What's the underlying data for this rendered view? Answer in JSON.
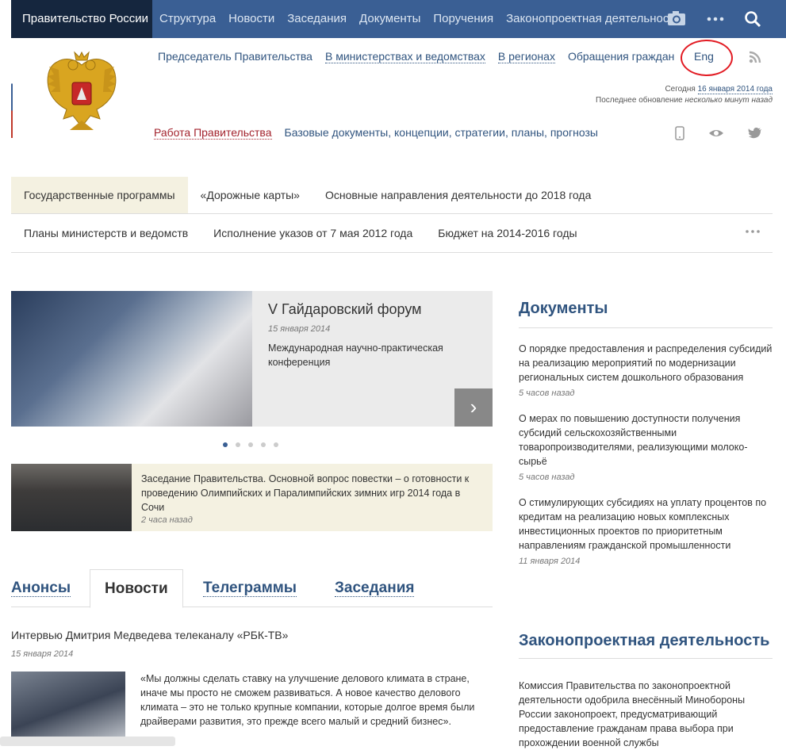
{
  "topbar": {
    "brand": "Правительство России",
    "nav": [
      "Структура",
      "Новости",
      "Заседания",
      "Документы",
      "Поручения",
      "Законопроектная деятельность"
    ],
    "icons": [
      "camera-icon",
      "more-icon",
      "search-icon"
    ]
  },
  "header": {
    "links": [
      "Председатель Правительства",
      "В министерствах и ведомствах",
      "В регионах",
      "Обращения граждан"
    ],
    "eng": "Eng",
    "today_label": "Сегодня",
    "today_date": "16 января 2014 года",
    "update_label": "Последнее обновление",
    "update_value": "несколько минут назад",
    "work_link": "Работа Правительства",
    "base_docs": "Базовые документы, концепции, стратегии, планы, прогнозы"
  },
  "tabs_row1": [
    "Государственные программы",
    "«Дорожные карты»",
    "Основные направления деятельности до 2018 года"
  ],
  "tabs_row2": [
    "Планы министерств и ведомств",
    "Исполнение указов от 7 мая 2012 года",
    "Бюджет на 2014-2016 годы"
  ],
  "hero": {
    "title": "V Гайдаровский форум",
    "date": "15 января 2014",
    "text": "Международная научно-практическая конференция",
    "arrow": "›",
    "page_count": 5,
    "active_page": 1
  },
  "news_banner": {
    "text": "Заседание Правительства. Основной вопрос повестки – о готовности к проведению Олимпийских и Паралимпийских зимних игр 2014 года в Сочи",
    "time": "2 часа назад"
  },
  "main_tabs": [
    "Анонсы",
    "Новости",
    "Телеграммы",
    "Заседания"
  ],
  "article": {
    "title": "Интервью Дмитрия Медведева телеканалу «РБК-ТВ»",
    "date": "15 января 2014",
    "text": "«Мы должны сделать ставку на улучшение делового климата в стране, иначе мы просто не сможем развиваться. А новое качество делового климата – это не только крупные компании, которые долгое время были драйверами развития, это прежде всего малый и средний бизнес»."
  },
  "documents": {
    "heading": "Документы",
    "items": [
      {
        "text": "О порядке предоставления и распределения субсидий на реализацию мероприятий по модернизации региональных систем дошкольного образования",
        "time": "5 часов назад"
      },
      {
        "text": "О мерах по повышению доступности получения субсидий сельскохозяйственными товаропроизводителями, реализующими молоко-сырьё",
        "time": "5 часов назад"
      },
      {
        "text": "О стимулирующих субсидиях на уплату процентов по кредитам на реализацию новых комплексных инвестиционных проектов по приоритетным направлениям гражданской промышленности",
        "time": "11 января 2014"
      }
    ]
  },
  "legislation": {
    "heading": "Законопроектная деятельность",
    "text": "Комиссия Правительства по законопроектной деятельности одобрила внесённый Минобороны России законопроект, предусматривающий предоставление гражданам права выбора при прохождении военной службы"
  }
}
